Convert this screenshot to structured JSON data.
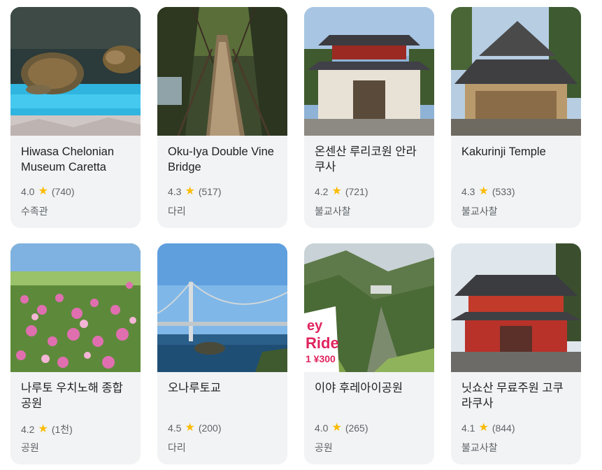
{
  "places": [
    {
      "title": "Hiwasa Chelonian Museum Caretta",
      "rating": "4.0",
      "reviews": "(740)",
      "category": "수족관",
      "thumb": "sea-turtle-aquarium-photo"
    },
    {
      "title": "Oku-Iya Double Vine Bridge",
      "rating": "4.3",
      "reviews": "(517)",
      "category": "다리",
      "thumb": "vine-bridge-photo"
    },
    {
      "title": "온센산 루리코원 안라쿠사",
      "rating": "4.2",
      "reviews": "(721)",
      "category": "불교사찰",
      "thumb": "temple-gate-photo"
    },
    {
      "title": "Kakurinji Temple",
      "rating": "4.3",
      "reviews": "(533)",
      "category": "불교사찰",
      "thumb": "temple-hall-photo"
    },
    {
      "title": "나루토 우치노해 종합공원",
      "rating": "4.2",
      "reviews": "(1천)",
      "category": "공원",
      "thumb": "cosmos-flower-field-photo"
    },
    {
      "title": "오나루토교",
      "rating": "4.5",
      "reviews": "(200)",
      "category": "다리",
      "thumb": "suspension-bridge-photo"
    },
    {
      "title": "이야 후레아이공원",
      "rating": "4.0",
      "reviews": "(265)",
      "category": "공원",
      "thumb": "valley-mountain-photo"
    },
    {
      "title": "닛쇼산 무료주원 고쿠라쿠사",
      "rating": "4.1",
      "reviews": "(844)",
      "category": "불교사찰",
      "thumb": "red-temple-gate-photo"
    }
  ],
  "photo_sign": {
    "line1": "ey",
    "line2": "Ride",
    "line3": "1 ¥300"
  },
  "colors": {
    "star": "#fbbc04",
    "card_bg": "#f1f3f4",
    "text": "#202124",
    "muted": "#5f6368"
  }
}
